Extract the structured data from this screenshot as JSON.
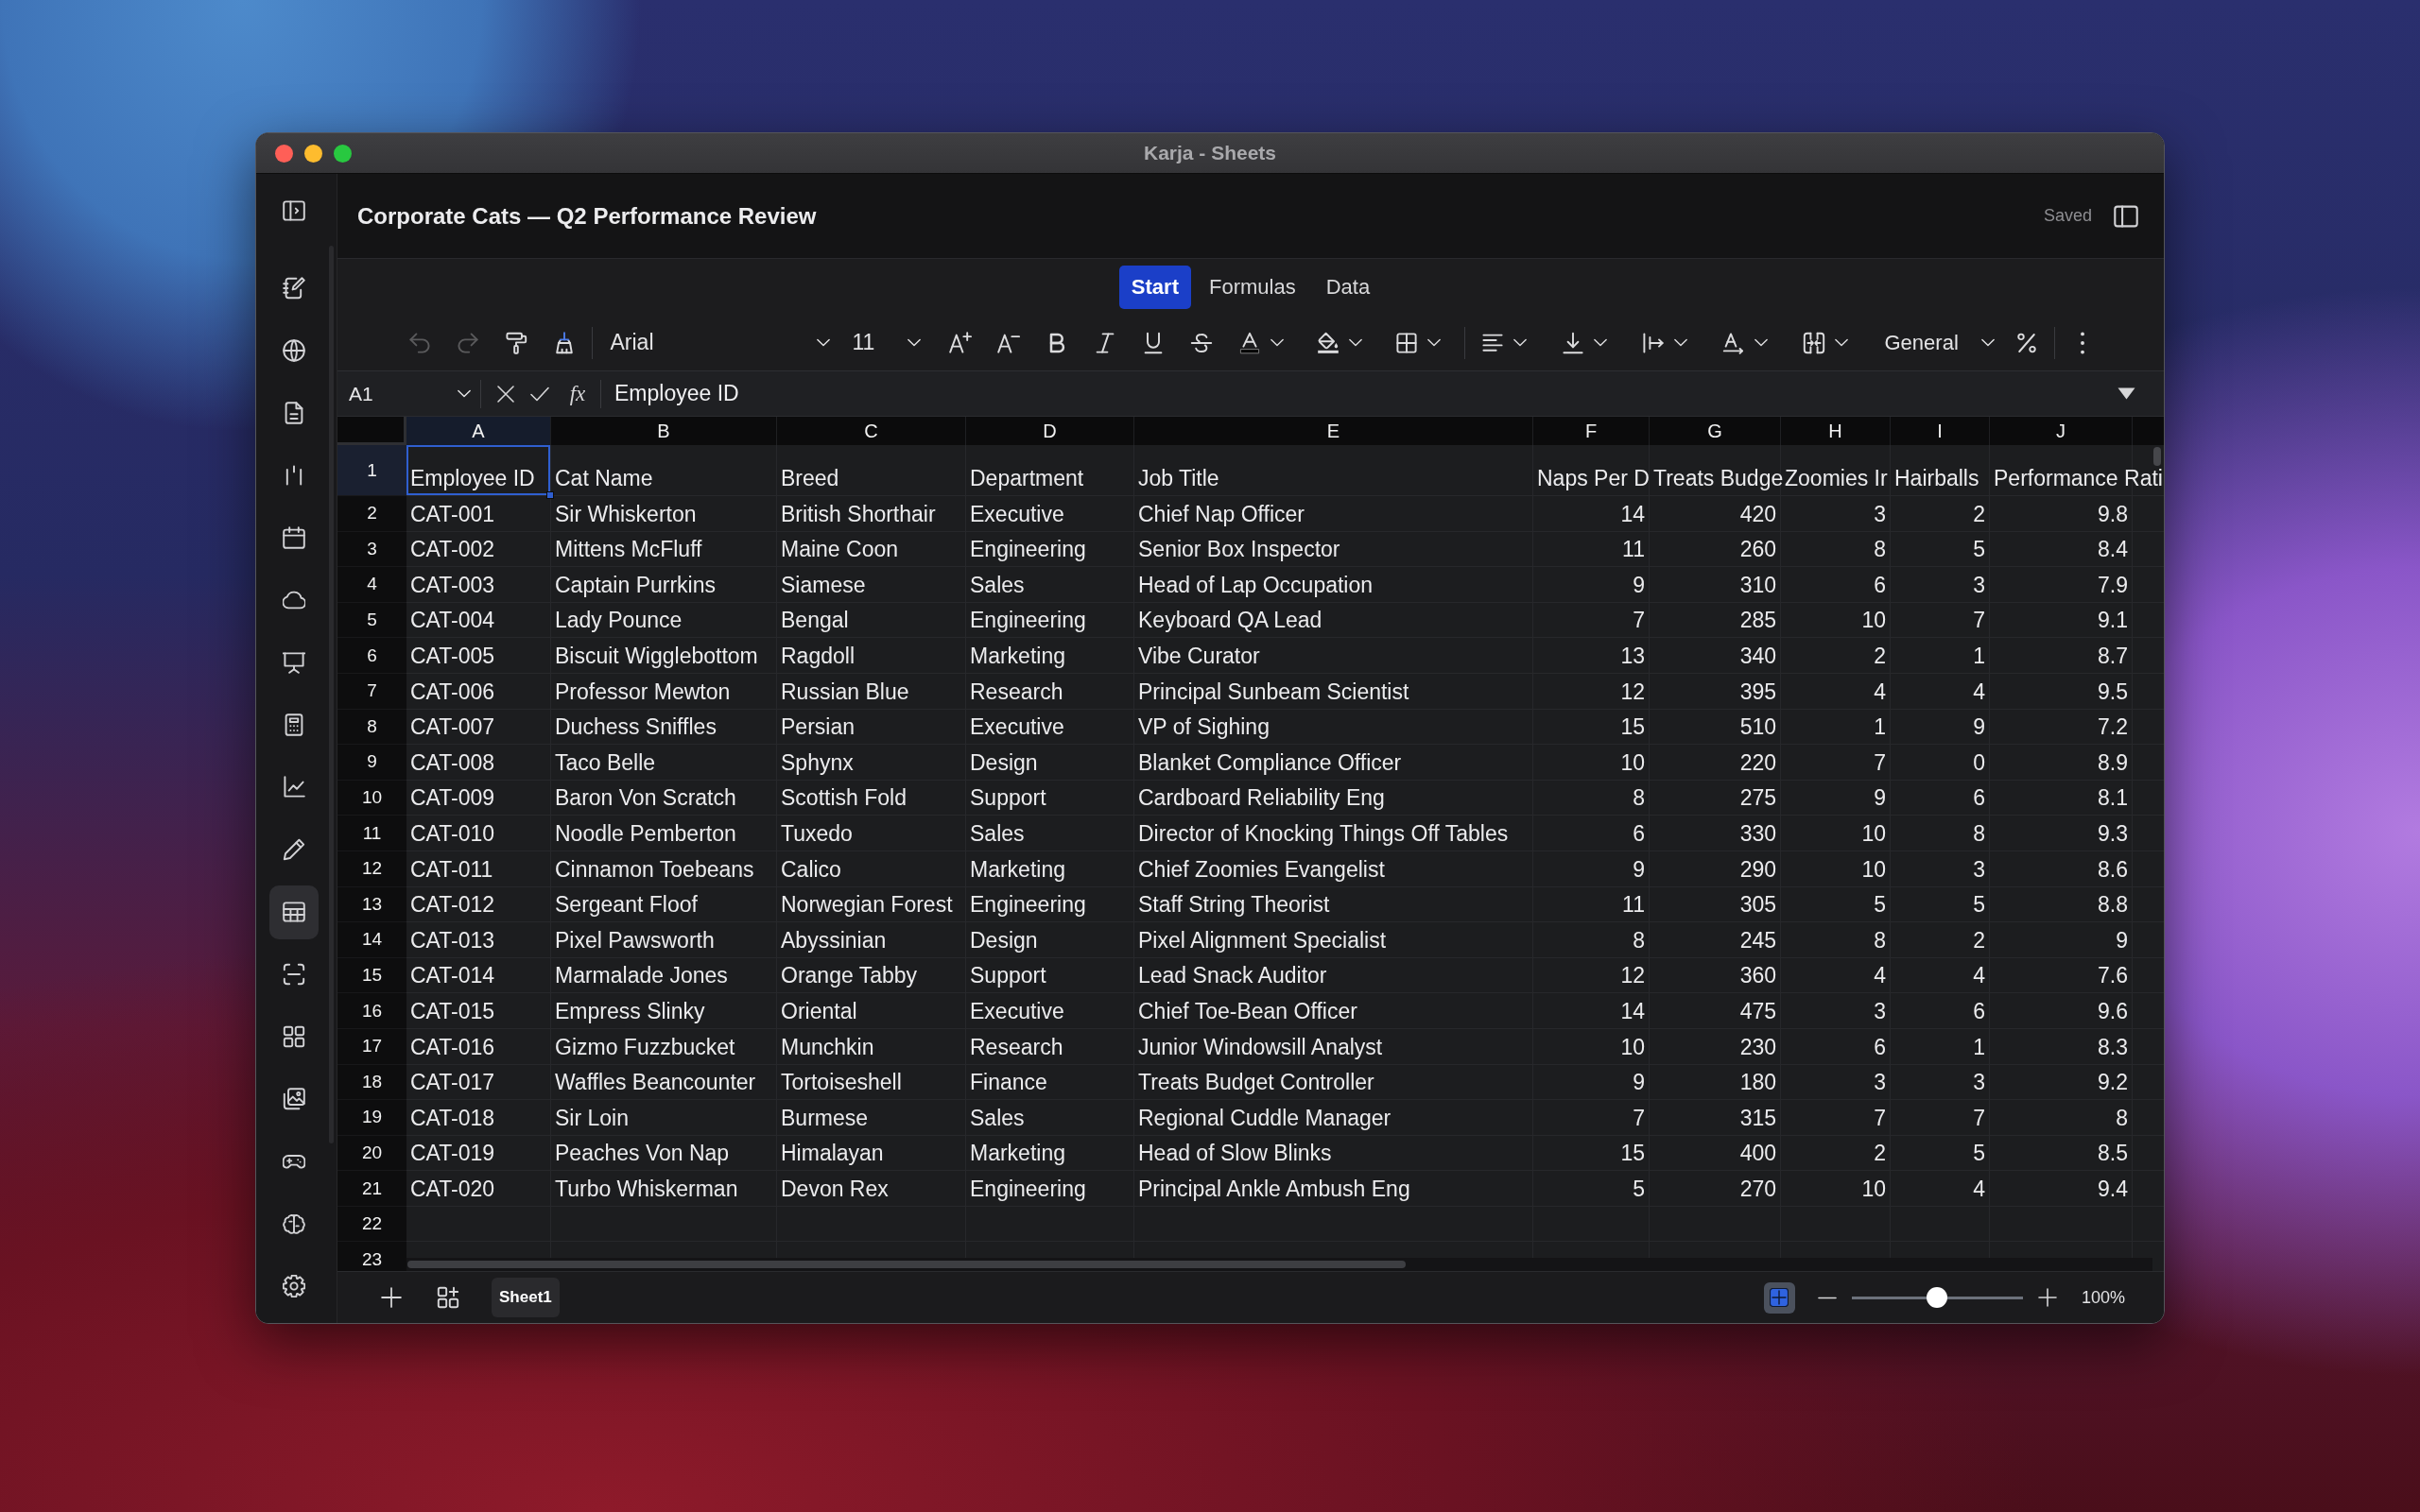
{
  "window": {
    "title": "Karja - Sheets"
  },
  "sidebar": {
    "items": [
      {
        "selected": false
      },
      {
        "selected": false
      },
      {
        "selected": false
      },
      {
        "selected": false
      },
      {
        "selected": false
      },
      {
        "selected": false
      },
      {
        "selected": false
      },
      {
        "selected": false
      },
      {
        "selected": false
      },
      {
        "selected": false
      },
      {
        "selected": true
      },
      {
        "selected": false
      },
      {
        "selected": false
      },
      {
        "selected": false
      },
      {
        "selected": false
      },
      {
        "selected": false
      }
    ]
  },
  "header": {
    "title": "Corporate Cats — Q2 Performance Review",
    "save_status": "Saved"
  },
  "tabs": [
    {
      "label": "Start",
      "selected": true
    },
    {
      "label": "Formulas",
      "selected": false
    },
    {
      "label": "Data",
      "selected": false
    }
  ],
  "toolbar": {
    "undo": {
      "disabled": true
    },
    "redo": {
      "disabled": true
    },
    "font": "Arial",
    "font_size": "11",
    "number_format": "General"
  },
  "formula_bar": {
    "cell_reference": "A1",
    "function_symbol": "fx",
    "formula": "Employee ID"
  },
  "sheet": {
    "columns": [
      {
        "label": "A",
        "selected": true,
        "kind": "text"
      },
      {
        "label": "B",
        "selected": false,
        "kind": "text"
      },
      {
        "label": "C",
        "selected": false,
        "kind": "text"
      },
      {
        "label": "D",
        "selected": false,
        "kind": "text"
      },
      {
        "label": "E",
        "selected": false,
        "kind": "text"
      },
      {
        "label": "F",
        "selected": false,
        "kind": "number"
      },
      {
        "label": "G",
        "selected": false,
        "kind": "number"
      },
      {
        "label": "H",
        "selected": false,
        "kind": "number"
      },
      {
        "label": "I",
        "selected": false,
        "kind": "number"
      },
      {
        "label": "J",
        "selected": false,
        "kind": "number"
      }
    ],
    "rows": [
      {
        "number": "1",
        "selected": true,
        "kind": "header",
        "cells": [
          "Employee ID",
          "Cat Name",
          "Breed",
          "Department",
          "Job Title",
          "Naps Per D",
          "Treats Budge",
          "Zoomies Ir",
          "Hairballs",
          "Performance Rati"
        ]
      },
      {
        "number": "2",
        "selected": false,
        "kind": "record",
        "cells": [
          "CAT-001",
          "Sir Whiskerton",
          "British Shorthair",
          "Executive",
          "Chief Nap Officer",
          "14",
          "420",
          "3",
          "2",
          "9.8"
        ]
      },
      {
        "number": "3",
        "selected": false,
        "kind": "record",
        "cells": [
          "CAT-002",
          "Mittens McFluff",
          "Maine Coon",
          "Engineering",
          "Senior Box Inspector",
          "11",
          "260",
          "8",
          "5",
          "8.4"
        ]
      },
      {
        "number": "4",
        "selected": false,
        "kind": "record",
        "cells": [
          "CAT-003",
          "Captain Purrkins",
          "Siamese",
          "Sales",
          "Head of Lap Occupation",
          "9",
          "310",
          "6",
          "3",
          "7.9"
        ]
      },
      {
        "number": "5",
        "selected": false,
        "kind": "record",
        "cells": [
          "CAT-004",
          "Lady Pounce",
          "Bengal",
          "Engineering",
          "Keyboard QA Lead",
          "7",
          "285",
          "10",
          "7",
          "9.1"
        ]
      },
      {
        "number": "6",
        "selected": false,
        "kind": "record",
        "cells": [
          "CAT-005",
          "Biscuit Wigglebottom",
          "Ragdoll",
          "Marketing",
          "Vibe Curator",
          "13",
          "340",
          "2",
          "1",
          "8.7"
        ]
      },
      {
        "number": "7",
        "selected": false,
        "kind": "record",
        "cells": [
          "CAT-006",
          "Professor Mewton",
          "Russian Blue",
          "Research",
          "Principal Sunbeam Scientist",
          "12",
          "395",
          "4",
          "4",
          "9.5"
        ]
      },
      {
        "number": "8",
        "selected": false,
        "kind": "record",
        "cells": [
          "CAT-007",
          "Duchess Sniffles",
          "Persian",
          "Executive",
          "VP of Sighing",
          "15",
          "510",
          "1",
          "9",
          "7.2"
        ]
      },
      {
        "number": "9",
        "selected": false,
        "kind": "record",
        "cells": [
          "CAT-008",
          "Taco Belle",
          "Sphynx",
          "Design",
          "Blanket Compliance Officer",
          "10",
          "220",
          "7",
          "0",
          "8.9"
        ]
      },
      {
        "number": "10",
        "selected": false,
        "kind": "record",
        "cells": [
          "CAT-009",
          "Baron Von Scratch",
          "Scottish Fold",
          "Support",
          "Cardboard Reliability Eng",
          "8",
          "275",
          "9",
          "6",
          "8.1"
        ]
      },
      {
        "number": "11",
        "selected": false,
        "kind": "record",
        "cells": [
          "CAT-010",
          "Noodle Pemberton",
          "Tuxedo",
          "Sales",
          "Director of Knocking Things Off Tables",
          "6",
          "330",
          "10",
          "8",
          "9.3"
        ]
      },
      {
        "number": "12",
        "selected": false,
        "kind": "record",
        "cells": [
          "CAT-011",
          "Cinnamon Toebeans",
          "Calico",
          "Marketing",
          "Chief Zoomies Evangelist",
          "9",
          "290",
          "10",
          "3",
          "8.6"
        ]
      },
      {
        "number": "13",
        "selected": false,
        "kind": "record",
        "cells": [
          "CAT-012",
          "Sergeant Floof",
          "Norwegian Forest",
          "Engineering",
          "Staff String Theorist",
          "11",
          "305",
          "5",
          "5",
          "8.8"
        ]
      },
      {
        "number": "14",
        "selected": false,
        "kind": "record",
        "cells": [
          "CAT-013",
          "Pixel Pawsworth",
          "Abyssinian",
          "Design",
          "Pixel Alignment Specialist",
          "8",
          "245",
          "8",
          "2",
          "9"
        ]
      },
      {
        "number": "15",
        "selected": false,
        "kind": "record",
        "cells": [
          "CAT-014",
          "Marmalade Jones",
          "Orange Tabby",
          "Support",
          "Lead Snack Auditor",
          "12",
          "360",
          "4",
          "4",
          "7.6"
        ]
      },
      {
        "number": "16",
        "selected": false,
        "kind": "record",
        "cells": [
          "CAT-015",
          "Empress Slinky",
          "Oriental",
          "Executive",
          "Chief Toe-Bean Officer",
          "14",
          "475",
          "3",
          "6",
          "9.6"
        ]
      },
      {
        "number": "17",
        "selected": false,
        "kind": "record",
        "cells": [
          "CAT-016",
          "Gizmo Fuzzbucket",
          "Munchkin",
          "Research",
          "Junior Windowsill Analyst",
          "10",
          "230",
          "6",
          "1",
          "8.3"
        ]
      },
      {
        "number": "18",
        "selected": false,
        "kind": "record",
        "cells": [
          "CAT-017",
          "Waffles Beancounter",
          "Tortoiseshell",
          "Finance",
          "Treats Budget Controller",
          "9",
          "180",
          "3",
          "3",
          "9.2"
        ]
      },
      {
        "number": "19",
        "selected": false,
        "kind": "record",
        "cells": [
          "CAT-018",
          "Sir Loin",
          "Burmese",
          "Sales",
          "Regional Cuddle Manager",
          "7",
          "315",
          "7",
          "7",
          "8"
        ]
      },
      {
        "number": "20",
        "selected": false,
        "kind": "record",
        "cells": [
          "CAT-019",
          "Peaches Von Nap",
          "Himalayan",
          "Marketing",
          "Head of Slow Blinks",
          "15",
          "400",
          "2",
          "5",
          "8.5"
        ]
      },
      {
        "number": "21",
        "selected": false,
        "kind": "record",
        "cells": [
          "CAT-020",
          "Turbo Whiskerman",
          "Devon Rex",
          "Engineering",
          "Principal Ankle Ambush Eng",
          "5",
          "270",
          "10",
          "4",
          "9.4"
        ]
      },
      {
        "number": "22",
        "selected": false,
        "kind": "record"
      },
      {
        "number": "23",
        "selected": false,
        "kind": "record"
      }
    ]
  },
  "bottom_bar": {
    "sheets": [
      {
        "label": "Sheet1",
        "selected": true
      }
    ],
    "view_toggle": {
      "on": true
    },
    "zoom": {
      "level": 0.5,
      "reading": "100%"
    }
  }
}
